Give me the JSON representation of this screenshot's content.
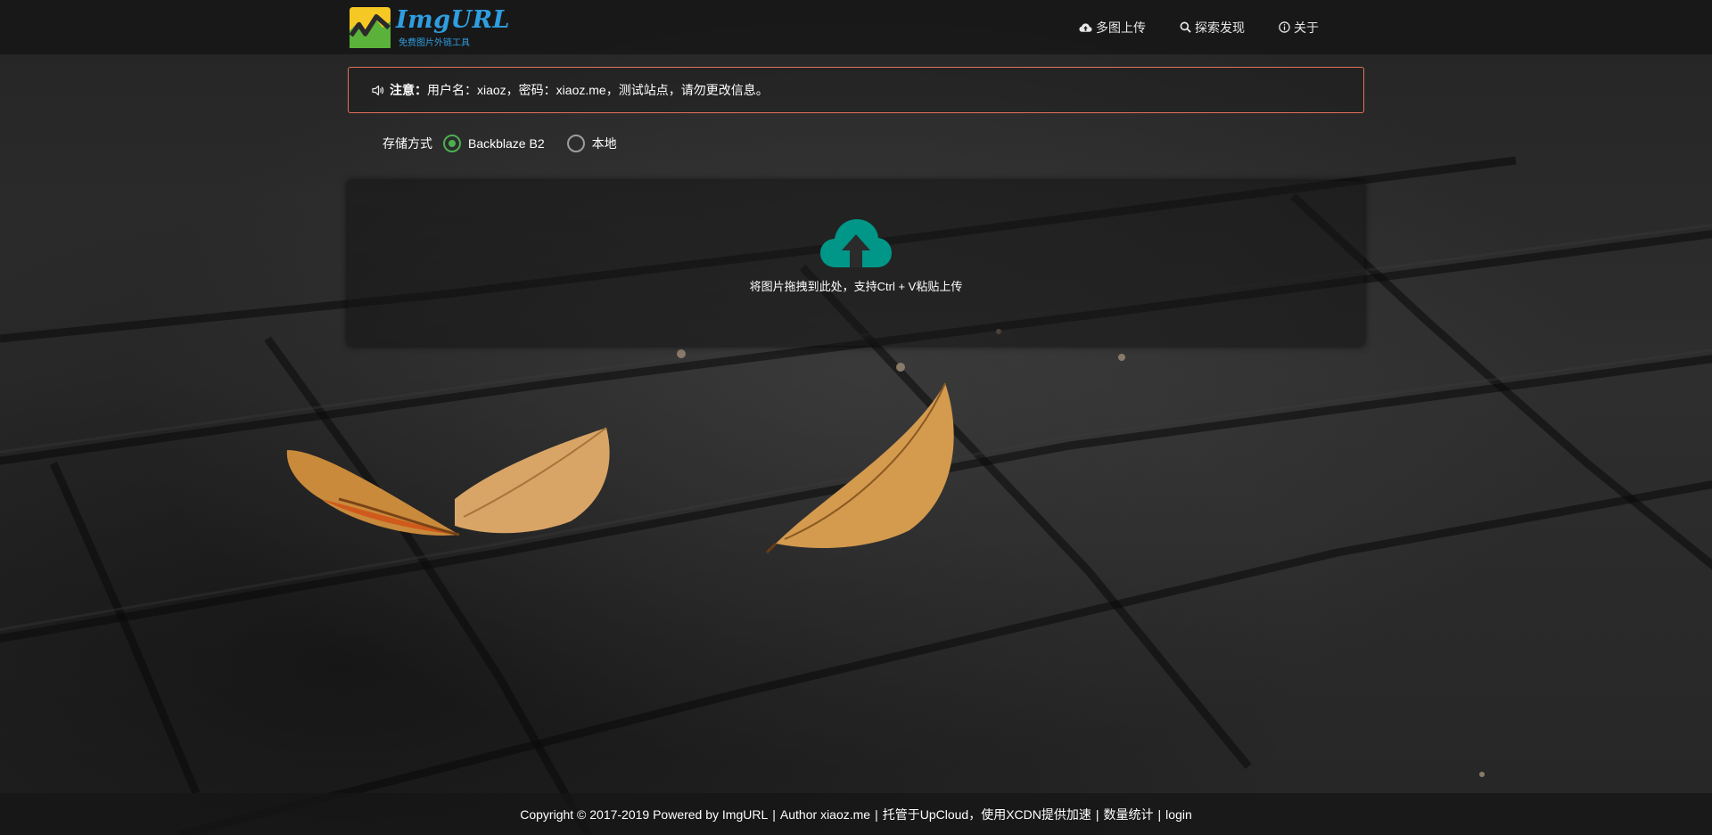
{
  "header": {
    "logo_title": "ImgURL",
    "logo_subtitle": "免费图片外链工具",
    "nav": [
      {
        "label": "多图上传",
        "icon": "cloud-upload-icon"
      },
      {
        "label": "探索发现",
        "icon": "search-icon"
      },
      {
        "label": "关于",
        "icon": "info-icon"
      }
    ]
  },
  "notice": {
    "icon": "volume-icon",
    "label": "注意：",
    "text": "用户名：xiaoz，密码：xiaoz.me，测试站点，请勿更改信息。",
    "border_color": "#e2725b"
  },
  "storage": {
    "label": "存储方式",
    "options": [
      {
        "label": "Backblaze B2",
        "checked": true
      },
      {
        "label": "本地",
        "checked": false
      }
    ],
    "accent": "#4caf50"
  },
  "upload": {
    "icon": "cloud-upload-icon",
    "icon_color": "#009688",
    "hint": "将图片拖拽到此处，支持Ctrl + V粘贴上传"
  },
  "footer": {
    "copyright": "Copyright © 2017-2019 Powered by",
    "imgurl_link": "ImgURL",
    "author_prefix": "Author",
    "author_link": "xiaoz.me",
    "hosting_text": "托管于UpCloud，使用XCDN提供加速",
    "stats_link": "数量统计",
    "login_link": "login",
    "separator": "|"
  }
}
